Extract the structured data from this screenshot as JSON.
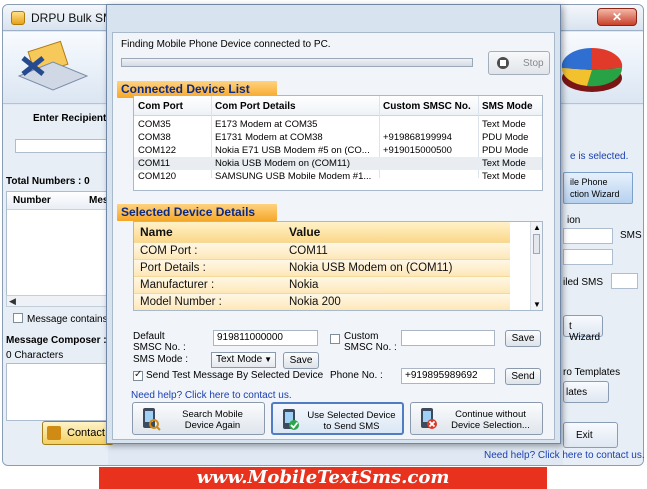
{
  "main_window": {
    "title": "DRPU Bulk SMS",
    "close_label": "✕",
    "left": {
      "recipient_label": "Enter Recipient",
      "total_label": "Total Numbers : 0",
      "col_number": "Number",
      "col_message": "Mes",
      "message_contains": "Message contains n",
      "composer_label": "Message Composer :",
      "characters": "0 Characters",
      "contact_btn": "Contact U"
    },
    "right": {
      "selected_text": "e is selected.",
      "wizard_line1": "ile Phone",
      "wizard_line2": "ction  Wizard",
      "ion_label": "ion",
      "sms_label": "SMS",
      "iled_sms_label": "iled SMS",
      "wizard_btn": "t Wizard",
      "templates_label": "ro Templates",
      "templates_btn": "lates",
      "exit_btn": "Exit"
    },
    "help_text": "Need help? Click here to contact us."
  },
  "dialog": {
    "finding_text": "Finding Mobile Phone Device connected to PC.",
    "progress": 0,
    "stop_btn": "Stop",
    "connected_header": "Connected Device List",
    "columns": [
      "Com Port",
      "Com Port Details",
      "Custom SMSC No.",
      "SMS Mode"
    ],
    "devices": [
      {
        "port": "COM35",
        "details": "E173 Modem at COM35",
        "smsc": "",
        "mode": "Text Mode"
      },
      {
        "port": "COM38",
        "details": "E1731 Modem at COM38",
        "smsc": "+919868199994",
        "mode": "PDU Mode"
      },
      {
        "port": "COM122",
        "details": "Nokia E71 USB Modem #5 on (CO...",
        "smsc": "+919015000500",
        "mode": "PDU Mode"
      },
      {
        "port": "COM11",
        "details": "Nokia USB Modem on (COM11)",
        "smsc": "",
        "mode": "Text Mode"
      },
      {
        "port": "COM120",
        "details": "SAMSUNG USB Mobile Modem #1...",
        "smsc": "",
        "mode": "Text Mode"
      }
    ],
    "selected_row_index": 3,
    "selected_header": "Selected Device Details",
    "detail_columns": [
      "Name",
      "Value"
    ],
    "details": [
      {
        "name": "COM Port :",
        "value": "COM11"
      },
      {
        "name": "Port Details :",
        "value": "Nokia USB Modem on (COM11)"
      },
      {
        "name": "Manufacturer :",
        "value": "Nokia"
      },
      {
        "name": "Model Number :",
        "value": "Nokia 200"
      }
    ],
    "default_smsc_label_1": "Default",
    "default_smsc_label_2": "SMSC No. :",
    "default_smsc_value": "919811000000",
    "custom_smsc_label_1": "Custom",
    "custom_smsc_label_2": "SMSC No. :",
    "custom_smsc_value": "",
    "custom_save_btn": "Save",
    "sms_mode_label": "SMS Mode :",
    "sms_mode_value": "Text Mode",
    "sms_mode_save_btn": "Save",
    "send_test_label": "Send Test Message By Selected Device",
    "send_test_checked": true,
    "phone_label": "Phone No. :",
    "phone_value": "+919895989692",
    "send_btn": "Send",
    "help_text": "Need help? Click here to contact us.",
    "btn_search": [
      "Search Mobile",
      "Device Again"
    ],
    "btn_use": [
      "Use Selected Device",
      "to Send SMS"
    ],
    "btn_continue": [
      "Continue without",
      "Device Selection..."
    ]
  },
  "footer": "www.MobileTextSms.com",
  "colors": {
    "section_header": "#f6a728",
    "footer_banner": "#e8321e",
    "link": "#1a3fb0"
  }
}
